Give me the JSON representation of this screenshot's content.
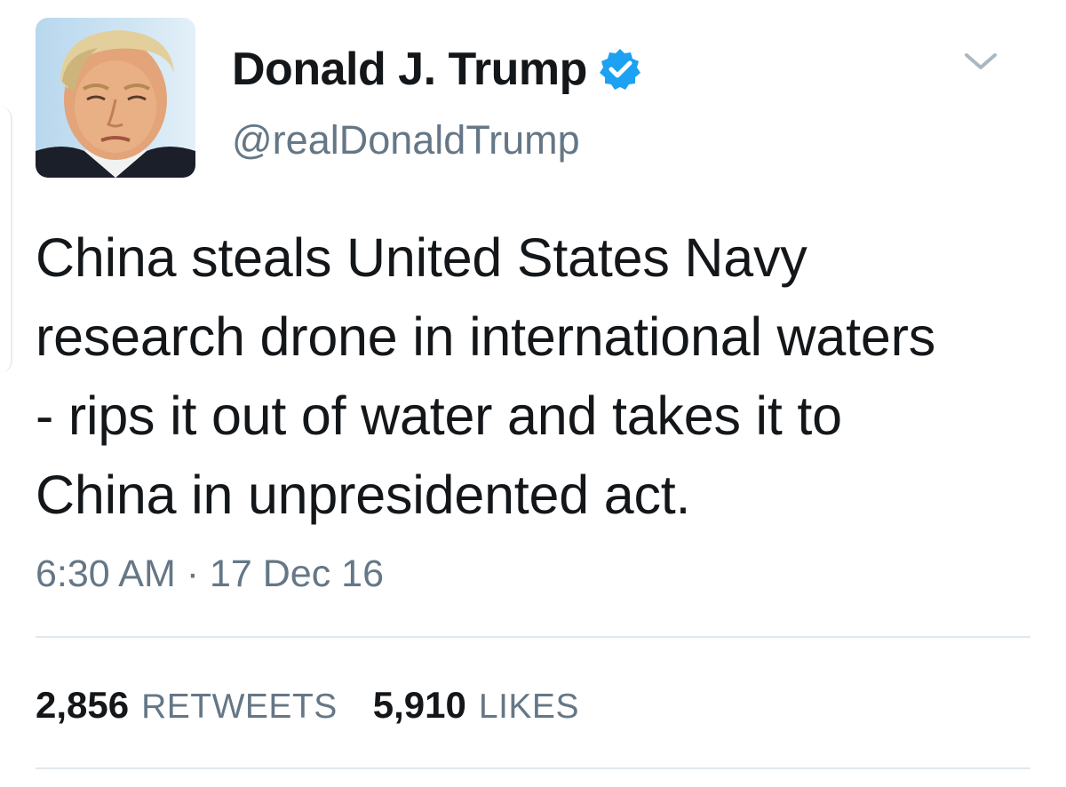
{
  "user": {
    "display_name": "Donald J. Trump",
    "handle": "@realDonaldTrump",
    "verified": true,
    "verified_color": "#1da1f2",
    "avatar_icon": "profile-photo",
    "menu_icon": "chevron-down-icon"
  },
  "tweet": {
    "text": "China steals United States Navy\nresearch drone in international waters\n- rips it out of water and takes it to\nChina in unpresidented act.",
    "timestamp": "6:30 AM · 17 Dec 16"
  },
  "stats": {
    "retweets_count": "2,856",
    "retweets_label": "RETWEETS",
    "likes_count": "5,910",
    "likes_label": "LIKES"
  },
  "colors": {
    "text_primary": "#14171a",
    "text_secondary": "#657786",
    "divider": "#e1e8ed"
  }
}
